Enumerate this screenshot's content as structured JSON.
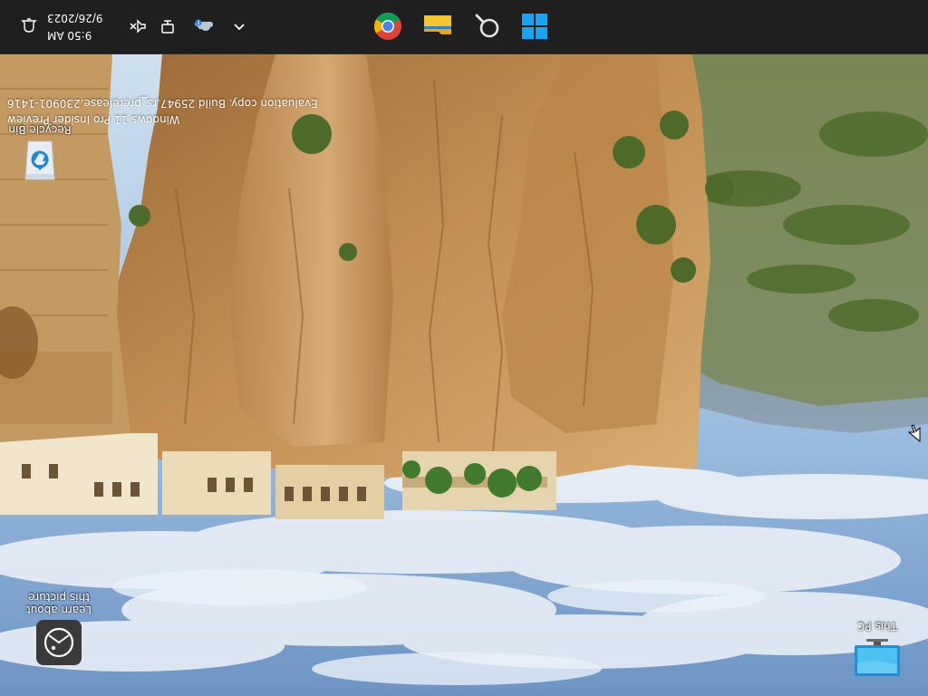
{
  "desktop": {
    "icons": [
      {
        "label": "This PC",
        "icon": "this-pc-icon"
      },
      {
        "label": "Recycle Bin",
        "icon": "recycle-bin-icon"
      },
      {
        "label": "Learn about this picture",
        "icon": "spotlight-camera-icon"
      }
    ],
    "watermark": {
      "line1": "Windows 11 Pro Insider Preview",
      "line2": "Evaluation copy. Build 25947.rs_prerelease.230901-1416"
    },
    "rotation_degrees": 180
  },
  "taskbar": {
    "pinned": [
      {
        "label": "Start",
        "icon": "windows-logo-icon"
      },
      {
        "label": "Search",
        "icon": "search-icon"
      },
      {
        "label": "File Explorer",
        "icon": "folder-icon"
      },
      {
        "label": "Google Chrome",
        "icon": "chrome-icon"
      }
    ],
    "tray": {
      "chevron_icon": "chevron-up-icon",
      "onedrive_icon": "onedrive-icon",
      "network_icon": "network-icon",
      "volume_icon": "volume-muted-icon",
      "notification_icon": "notification-bell-icon"
    },
    "clock": {
      "time": "9:50 AM",
      "date": "9/26/2023"
    }
  },
  "colors": {
    "taskbar_bg": "#1f1f1f",
    "windows_blue": "#1aa3f0",
    "folder_yellow": "#f7c433"
  }
}
